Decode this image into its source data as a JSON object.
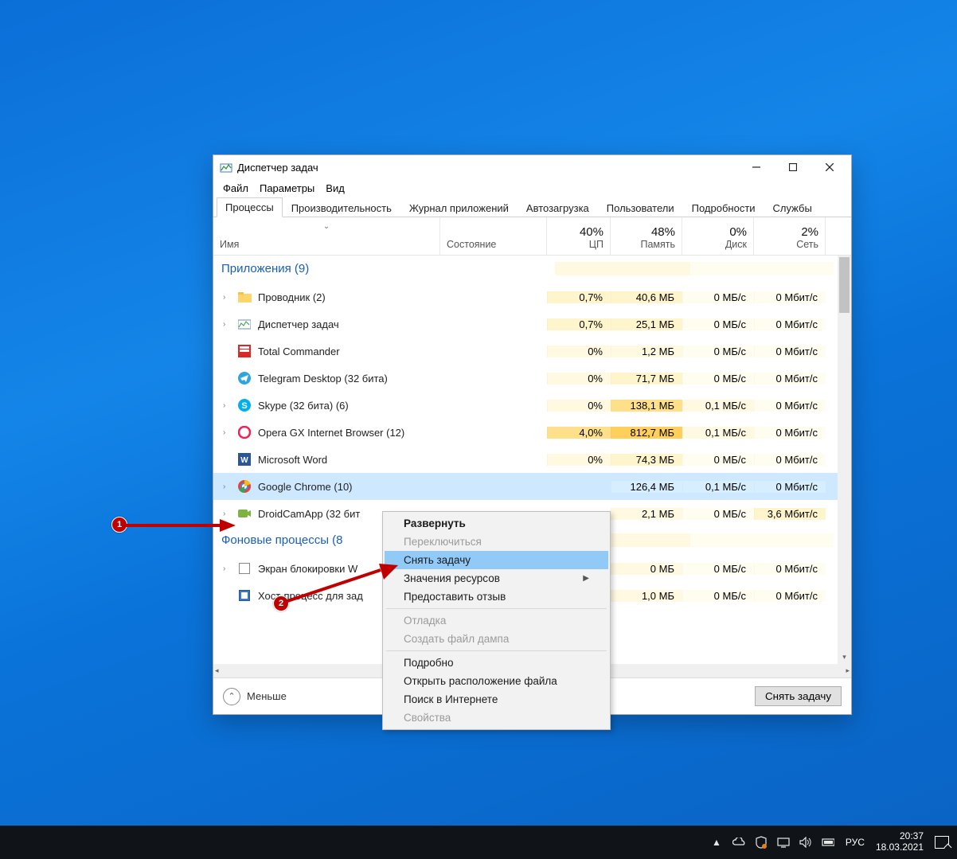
{
  "window": {
    "title": "Диспетчер задач",
    "menu": {
      "file": "Файл",
      "options": "Параметры",
      "view": "Вид"
    },
    "tabs": {
      "processes": "Процессы",
      "performance": "Производительность",
      "apphistory": "Журнал приложений",
      "startup": "Автозагрузка",
      "users": "Пользователи",
      "details": "Подробности",
      "services": "Службы"
    }
  },
  "columns": {
    "name": "Имя",
    "state": "Состояние",
    "cpu_pct": "40%",
    "cpu_lbl": "ЦП",
    "mem_pct": "48%",
    "mem_lbl": "Память",
    "disk_pct": "0%",
    "disk_lbl": "Диск",
    "net_pct": "2%",
    "net_lbl": "Сеть"
  },
  "groups": {
    "apps": "Приложения (9)",
    "bg": "Фоновые процессы (8"
  },
  "rows": {
    "explorer": {
      "name": "Проводник (2)",
      "cpu": "0,7%",
      "mem": "40,6 МБ",
      "disk": "0 МБ/с",
      "net": "0 Мбит/с"
    },
    "taskmgr": {
      "name": "Диспетчер задач",
      "cpu": "0,7%",
      "mem": "25,1 МБ",
      "disk": "0 МБ/с",
      "net": "0 Мбит/с"
    },
    "totalcmd": {
      "name": "Total Commander",
      "cpu": "0%",
      "mem": "1,2 МБ",
      "disk": "0 МБ/с",
      "net": "0 Мбит/с"
    },
    "telegram": {
      "name": "Telegram Desktop (32 бита)",
      "cpu": "0%",
      "mem": "71,7 МБ",
      "disk": "0 МБ/с",
      "net": "0 Мбит/с"
    },
    "skype": {
      "name": "Skype (32 бита) (6)",
      "cpu": "0%",
      "mem": "138,1 МБ",
      "disk": "0,1 МБ/с",
      "net": "0 Мбит/с"
    },
    "opera": {
      "name": "Opera GX Internet Browser (12)",
      "cpu": "4,0%",
      "mem": "812,7 МБ",
      "disk": "0,1 МБ/с",
      "net": "0 Мбит/с"
    },
    "word": {
      "name": "Microsoft Word",
      "cpu": "0%",
      "mem": "74,3 МБ",
      "disk": "0 МБ/с",
      "net": "0 Мбит/с"
    },
    "chrome": {
      "name": "Google Chrome (10)",
      "cpu": "",
      "mem": "126,4 МБ",
      "disk": "0,1 МБ/с",
      "net": "0 Мбит/с"
    },
    "droidcam": {
      "name": "DroidCamApp (32 бит",
      "cpu": "",
      "mem": "2,1 МБ",
      "disk": "0 МБ/с",
      "net": "3,6 Мбит/с"
    },
    "lockscreen": {
      "name": "Экран блокировки W",
      "cpu": "",
      "mem": "0 МБ",
      "disk": "0 МБ/с",
      "net": "0 Мбит/с"
    },
    "hostproc": {
      "name": "Хост-процесс для зад",
      "cpu": "",
      "mem": "1,0 МБ",
      "disk": "0 МБ/с",
      "net": "0 Мбит/с"
    }
  },
  "footer": {
    "fewer": "Меньше",
    "endtask": "Снять задачу"
  },
  "context_menu": {
    "expand": "Развернуть",
    "switch": "Переключиться",
    "endtask": "Снять задачу",
    "resource": "Значения ресурсов",
    "feedback": "Предоставить отзыв",
    "debug": "Отладка",
    "dump": "Создать файл дампа",
    "details": "Подробно",
    "openloc": "Открыть расположение файла",
    "search": "Поиск в Интернете",
    "props": "Свойства"
  },
  "annotations": {
    "one": "1",
    "two": "2"
  },
  "taskbar": {
    "lang": "РУС",
    "time": "20:37",
    "date": "18.03.2021",
    "chevron": "▲"
  }
}
